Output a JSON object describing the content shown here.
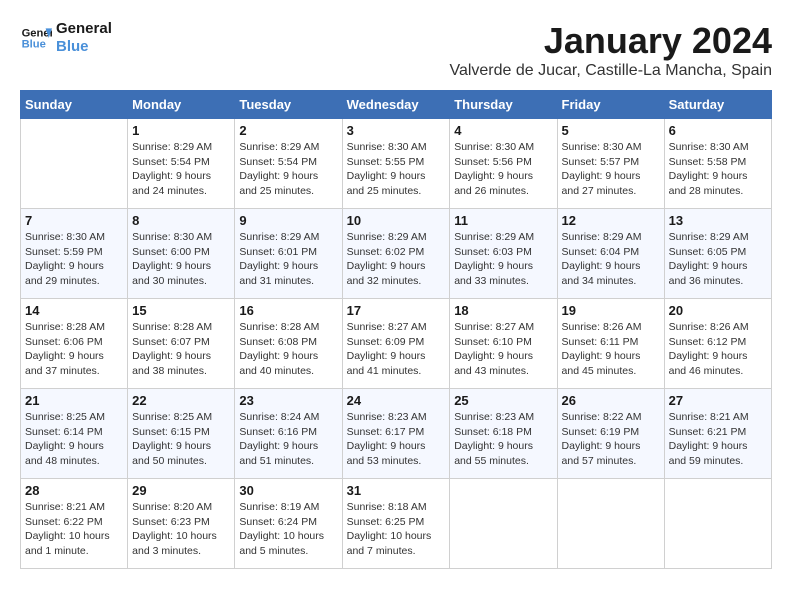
{
  "logo": {
    "line1": "General",
    "line2": "Blue"
  },
  "title": "January 2024",
  "location": "Valverde de Jucar, Castille-La Mancha, Spain",
  "days_of_week": [
    "Sunday",
    "Monday",
    "Tuesday",
    "Wednesday",
    "Thursday",
    "Friday",
    "Saturday"
  ],
  "weeks": [
    [
      {
        "day": "",
        "info": ""
      },
      {
        "day": "1",
        "info": "Sunrise: 8:29 AM\nSunset: 5:54 PM\nDaylight: 9 hours\nand 24 minutes."
      },
      {
        "day": "2",
        "info": "Sunrise: 8:29 AM\nSunset: 5:54 PM\nDaylight: 9 hours\nand 25 minutes."
      },
      {
        "day": "3",
        "info": "Sunrise: 8:30 AM\nSunset: 5:55 PM\nDaylight: 9 hours\nand 25 minutes."
      },
      {
        "day": "4",
        "info": "Sunrise: 8:30 AM\nSunset: 5:56 PM\nDaylight: 9 hours\nand 26 minutes."
      },
      {
        "day": "5",
        "info": "Sunrise: 8:30 AM\nSunset: 5:57 PM\nDaylight: 9 hours\nand 27 minutes."
      },
      {
        "day": "6",
        "info": "Sunrise: 8:30 AM\nSunset: 5:58 PM\nDaylight: 9 hours\nand 28 minutes."
      }
    ],
    [
      {
        "day": "7",
        "info": "Sunrise: 8:30 AM\nSunset: 5:59 PM\nDaylight: 9 hours\nand 29 minutes."
      },
      {
        "day": "8",
        "info": "Sunrise: 8:30 AM\nSunset: 6:00 PM\nDaylight: 9 hours\nand 30 minutes."
      },
      {
        "day": "9",
        "info": "Sunrise: 8:29 AM\nSunset: 6:01 PM\nDaylight: 9 hours\nand 31 minutes."
      },
      {
        "day": "10",
        "info": "Sunrise: 8:29 AM\nSunset: 6:02 PM\nDaylight: 9 hours\nand 32 minutes."
      },
      {
        "day": "11",
        "info": "Sunrise: 8:29 AM\nSunset: 6:03 PM\nDaylight: 9 hours\nand 33 minutes."
      },
      {
        "day": "12",
        "info": "Sunrise: 8:29 AM\nSunset: 6:04 PM\nDaylight: 9 hours\nand 34 minutes."
      },
      {
        "day": "13",
        "info": "Sunrise: 8:29 AM\nSunset: 6:05 PM\nDaylight: 9 hours\nand 36 minutes."
      }
    ],
    [
      {
        "day": "14",
        "info": "Sunrise: 8:28 AM\nSunset: 6:06 PM\nDaylight: 9 hours\nand 37 minutes."
      },
      {
        "day": "15",
        "info": "Sunrise: 8:28 AM\nSunset: 6:07 PM\nDaylight: 9 hours\nand 38 minutes."
      },
      {
        "day": "16",
        "info": "Sunrise: 8:28 AM\nSunset: 6:08 PM\nDaylight: 9 hours\nand 40 minutes."
      },
      {
        "day": "17",
        "info": "Sunrise: 8:27 AM\nSunset: 6:09 PM\nDaylight: 9 hours\nand 41 minutes."
      },
      {
        "day": "18",
        "info": "Sunrise: 8:27 AM\nSunset: 6:10 PM\nDaylight: 9 hours\nand 43 minutes."
      },
      {
        "day": "19",
        "info": "Sunrise: 8:26 AM\nSunset: 6:11 PM\nDaylight: 9 hours\nand 45 minutes."
      },
      {
        "day": "20",
        "info": "Sunrise: 8:26 AM\nSunset: 6:12 PM\nDaylight: 9 hours\nand 46 minutes."
      }
    ],
    [
      {
        "day": "21",
        "info": "Sunrise: 8:25 AM\nSunset: 6:14 PM\nDaylight: 9 hours\nand 48 minutes."
      },
      {
        "day": "22",
        "info": "Sunrise: 8:25 AM\nSunset: 6:15 PM\nDaylight: 9 hours\nand 50 minutes."
      },
      {
        "day": "23",
        "info": "Sunrise: 8:24 AM\nSunset: 6:16 PM\nDaylight: 9 hours\nand 51 minutes."
      },
      {
        "day": "24",
        "info": "Sunrise: 8:23 AM\nSunset: 6:17 PM\nDaylight: 9 hours\nand 53 minutes."
      },
      {
        "day": "25",
        "info": "Sunrise: 8:23 AM\nSunset: 6:18 PM\nDaylight: 9 hours\nand 55 minutes."
      },
      {
        "day": "26",
        "info": "Sunrise: 8:22 AM\nSunset: 6:19 PM\nDaylight: 9 hours\nand 57 minutes."
      },
      {
        "day": "27",
        "info": "Sunrise: 8:21 AM\nSunset: 6:21 PM\nDaylight: 9 hours\nand 59 minutes."
      }
    ],
    [
      {
        "day": "28",
        "info": "Sunrise: 8:21 AM\nSunset: 6:22 PM\nDaylight: 10 hours\nand 1 minute."
      },
      {
        "day": "29",
        "info": "Sunrise: 8:20 AM\nSunset: 6:23 PM\nDaylight: 10 hours\nand 3 minutes."
      },
      {
        "day": "30",
        "info": "Sunrise: 8:19 AM\nSunset: 6:24 PM\nDaylight: 10 hours\nand 5 minutes."
      },
      {
        "day": "31",
        "info": "Sunrise: 8:18 AM\nSunset: 6:25 PM\nDaylight: 10 hours\nand 7 minutes."
      },
      {
        "day": "",
        "info": ""
      },
      {
        "day": "",
        "info": ""
      },
      {
        "day": "",
        "info": ""
      }
    ]
  ]
}
